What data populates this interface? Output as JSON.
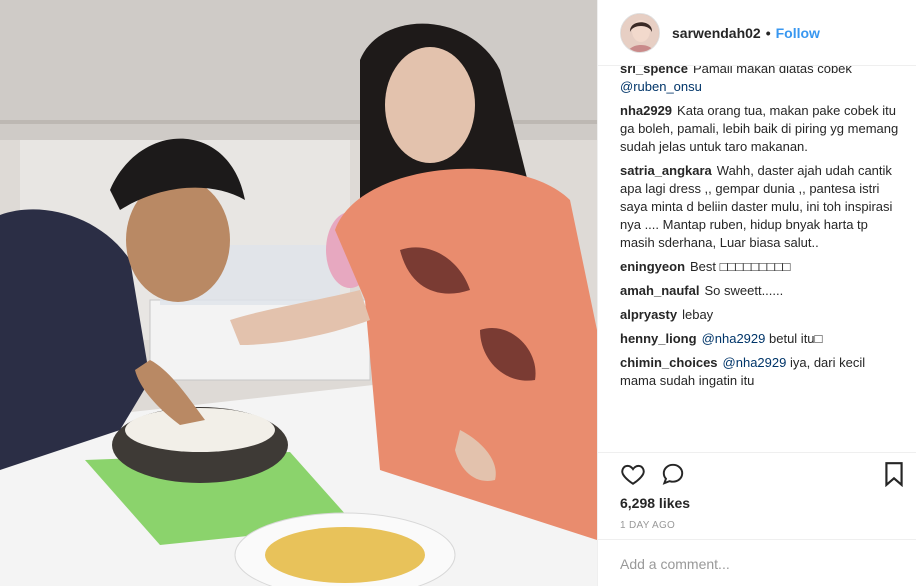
{
  "post": {
    "photo_icon": "photo"
  },
  "header": {
    "username": "sarwendah02",
    "separator": "•",
    "follow_label": "Follow"
  },
  "comments": [
    {
      "user": "sri_spence",
      "text": "Pamali makan diatas cobek",
      "mention": "@ruben_onsu",
      "mention_first": false
    },
    {
      "user": "nha2929",
      "text": "Kata orang tua, makan pake cobek itu ga boleh, pamali, lebih baik di piring yg memang sudah jelas untuk taro makanan."
    },
    {
      "user": "satria_angkara",
      "text": "Wahh, daster ajah udah cantik apa lagi dress ,, gempar dunia ,, pantesa istri saya minta d beliin daster mulu, ini toh inspirasi nya .... Mantap ruben, hidup bnyak harta tp masih sderhana, Luar biasa salut.."
    },
    {
      "user": "eningyeon",
      "text": "Best □□□□□□□□□"
    },
    {
      "user": "amah_naufal",
      "text": "So sweett......"
    },
    {
      "user": "alpryasty",
      "text": "lebay"
    },
    {
      "user": "henny_liong",
      "mention": "@nha2929",
      "text": "betul itu□"
    },
    {
      "user": "chimin_choices",
      "mention": "@nha2929",
      "text": "iya, dari kecil mama sudah ingatin itu"
    }
  ],
  "actions": {
    "like_icon": "heart-outline",
    "comment_icon": "speech-bubble",
    "save_icon": "bookmark"
  },
  "likes_text": "6,298 likes",
  "time_ago": "1 DAY AGO",
  "add_comment_placeholder": "Add a comment...",
  "colors": {
    "follow": "#3897f0",
    "mention": "#003569",
    "muted": "#999999",
    "border": "#efefef"
  }
}
